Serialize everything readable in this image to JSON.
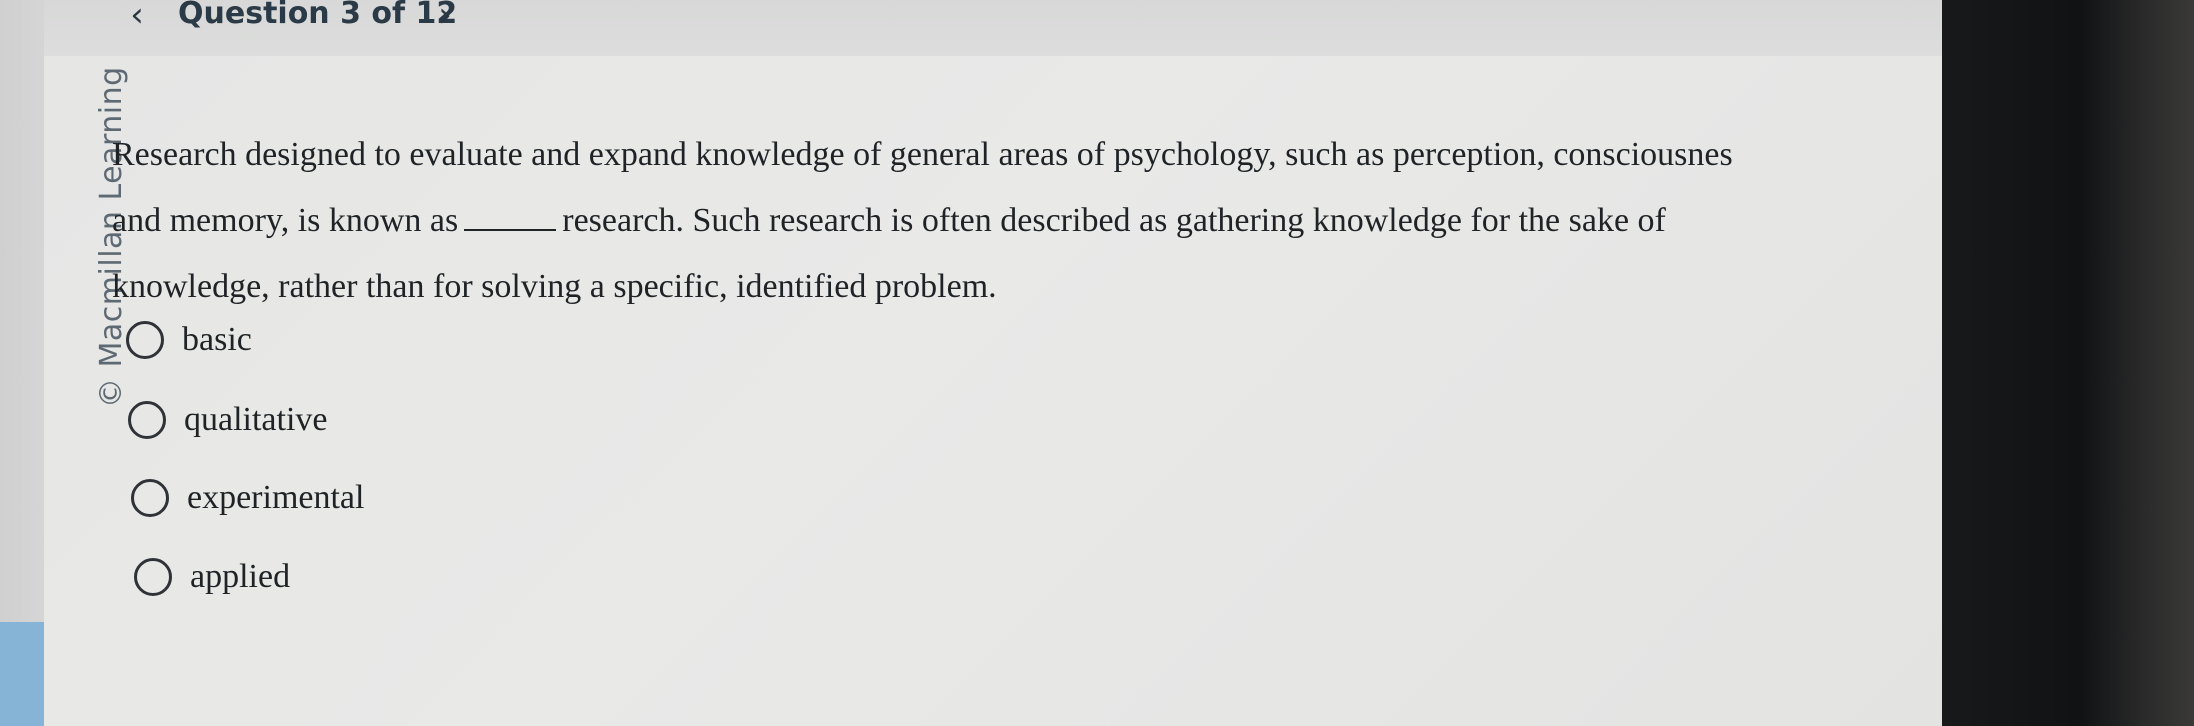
{
  "nav": {
    "prev_icon": "chevron-left-icon",
    "next_icon": "chevron-right-icon",
    "prev_glyph": "‹",
    "next_glyph": "›",
    "question_counter": "Question 3 of 12"
  },
  "sidebar": {
    "copyright": "© Macmillan Learning"
  },
  "question": {
    "line1": "Research designed to evaluate and expand knowledge of general areas of psychology, such as perception, consciousnes",
    "line2_before": "and memory, is known as",
    "line2_after": "research. Such research is often described as gathering knowledge for the sake of",
    "line3": "knowledge, rather than for solving a specific, identified problem."
  },
  "options": [
    {
      "label": "basic",
      "selected": false
    },
    {
      "label": "qualitative",
      "selected": false
    },
    {
      "label": "experimental",
      "selected": false
    },
    {
      "label": "applied",
      "selected": false
    }
  ],
  "colors": {
    "accent_strip": "#86b4d6",
    "text": "#1f2326",
    "panel": "#e7e7e6"
  }
}
